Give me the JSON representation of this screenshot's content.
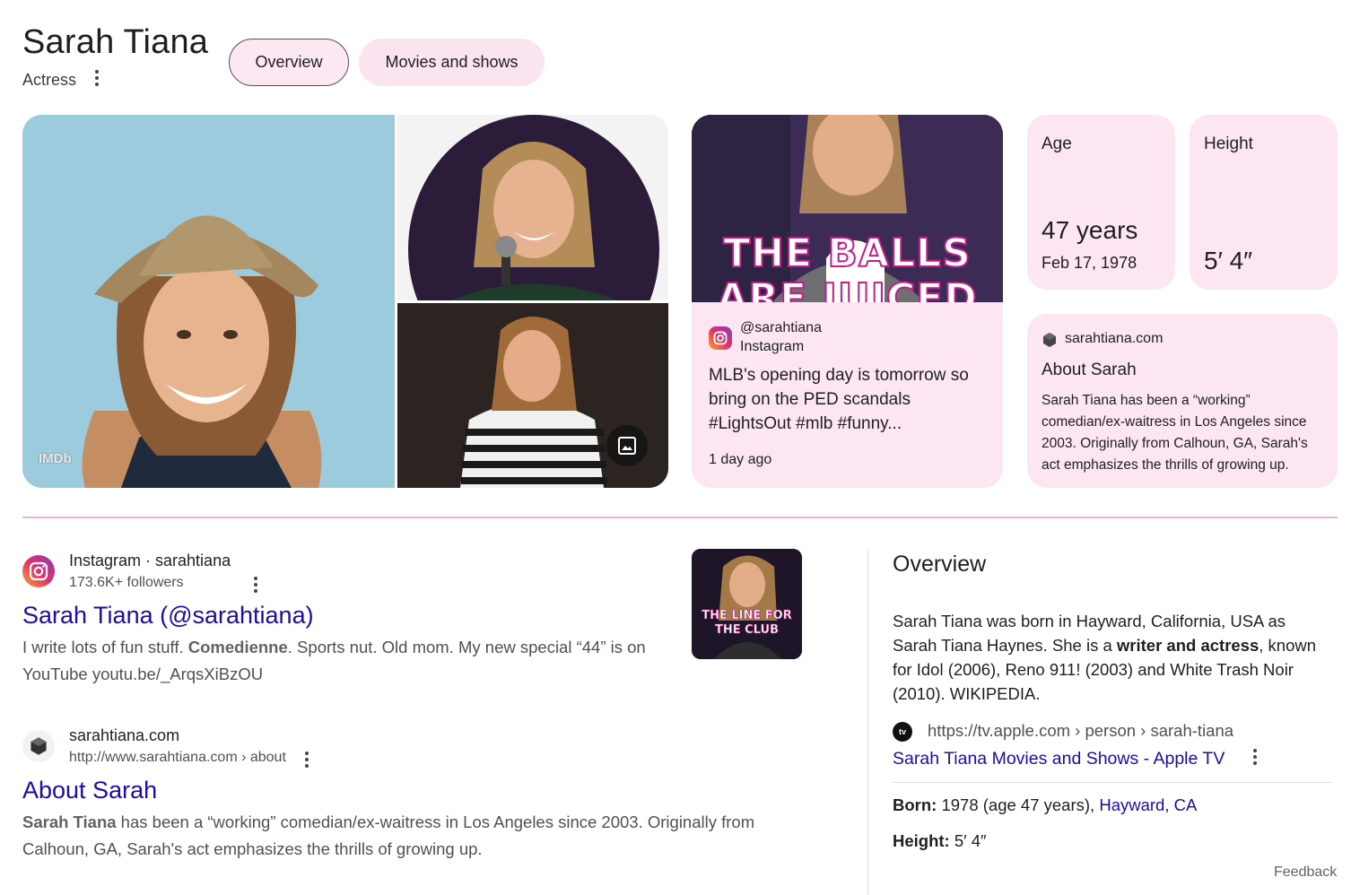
{
  "header": {
    "title": "Sarah Tiana",
    "subtitle": "Actress",
    "tabs": [
      {
        "label": "Overview",
        "active": true
      },
      {
        "label": "Movies and shows",
        "active": false
      }
    ]
  },
  "images": {
    "main_source": "IMDb",
    "ig_overlay_text": "THE BALLS ARE JUICED",
    "thumb_overlay_text_1": "THE LINE FOR",
    "thumb_overlay_text_2": "THE CLUB"
  },
  "instagram_card": {
    "handle": "@sarahtiana",
    "source": "Instagram",
    "text": "MLB's opening day is tomorrow so bring on the PED scandals #LightsOut #mlb #funny...",
    "time": "1 day ago"
  },
  "age_card": {
    "label": "Age",
    "value": "47 years",
    "sub": "Feb 17, 1978"
  },
  "height_card": {
    "label": "Height",
    "value": "5′ 4″"
  },
  "about_card": {
    "site": "sarahtiana.com",
    "title": "About Sarah",
    "body": "Sarah Tiana has been a “working” comedian/ex-waitress in Los Angeles since 2003. Originally from Calhoun, GA, Sarah's act emphasizes the thrills of growing up."
  },
  "results": [
    {
      "site": "Instagram · sarahtiana",
      "meta": "173.6K+ followers",
      "title": "Sarah Tiana (@sarahtiana)",
      "snippet_pre": "I write lots of fun stuff. ",
      "snippet_bold": "Comedienne",
      "snippet_post": ". Sports nut. Old mom. My new special “44” is on YouTube youtu.be/_ArqsXiBzOU"
    },
    {
      "site": "sarahtiana.com",
      "meta": "http://www.sarahtiana.com › about",
      "title": "About Sarah",
      "snippet_bold": "Sarah Tiana",
      "snippet_post": " has been a “working” comedian/ex-waitress in Los Angeles since 2003. Originally from Calhoun, GA, Sarah's act emphasizes the thrills of growing up."
    }
  ],
  "overview": {
    "heading": "Overview",
    "body_pre": "Sarah Tiana was born in Hayward, California, USA as Sarah Tiana Haynes. She is a ",
    "body_bold": "writer and actress",
    "body_post": ", known for Idol (2006), Reno 911! (2003) and White Trash Noir (2010). WIKIPEDIA.",
    "tv_icon": "tv",
    "tv_url": "https://tv.apple.com › person › sarah-tiana",
    "tv_link": "Sarah Tiana Movies and Shows - Apple TV",
    "born_label": "Born:",
    "born_value": "1978 (age 47 years), ",
    "born_place": "Hayward, CA",
    "height_label": "Height:",
    "height_value": "5′ 4″"
  },
  "footer": {
    "feedback": "Feedback"
  },
  "colors": {
    "accent_pink": "#fbe6f1",
    "link_blue": "#1a0dab",
    "divider_pink": "#e7b4dd"
  }
}
